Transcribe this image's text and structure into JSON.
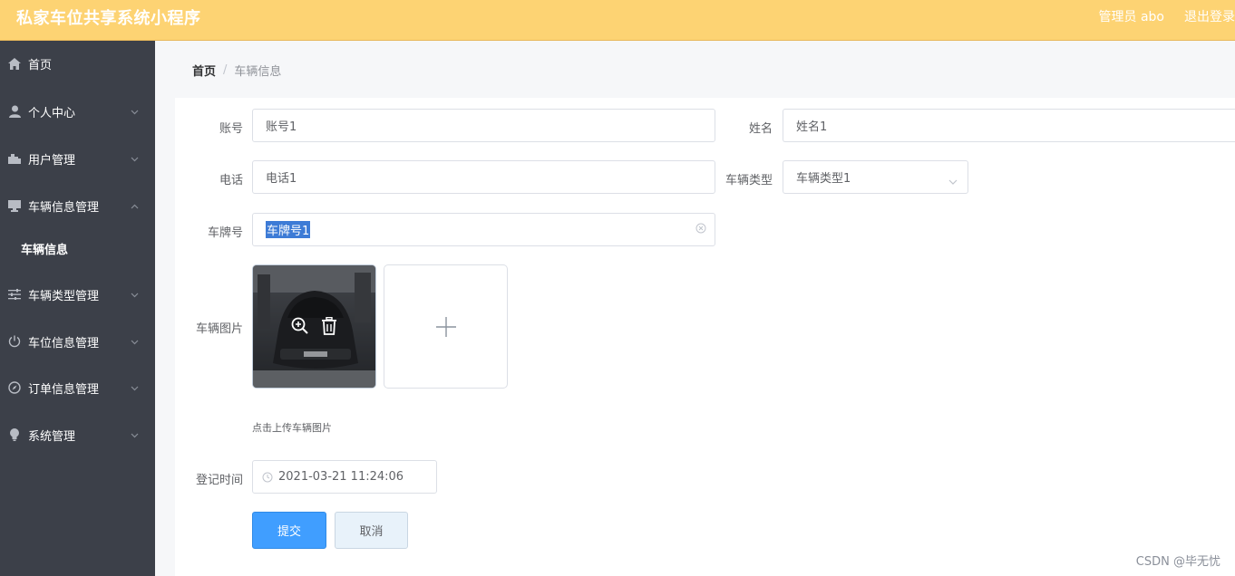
{
  "header": {
    "title": "私家车位共享系统小程序",
    "admin": "管理员 abo",
    "logout": "退出登录"
  },
  "sidebar": {
    "items": [
      {
        "label": "首页",
        "icon": "home-icon"
      },
      {
        "label": "个人中心",
        "icon": "user-icon"
      },
      {
        "label": "用户管理",
        "icon": "users-icon"
      },
      {
        "label": "车辆信息管理",
        "icon": "monitor-icon"
      },
      {
        "label": "车辆类型管理",
        "icon": "sliders-icon"
      },
      {
        "label": "车位信息管理",
        "icon": "power-icon"
      },
      {
        "label": "订单信息管理",
        "icon": "compass-icon"
      },
      {
        "label": "系统管理",
        "icon": "bulb-icon"
      }
    ],
    "sub_active": "车辆信息"
  },
  "breadcrumb": {
    "home": "首页",
    "separator": "/",
    "current": "车辆信息"
  },
  "form": {
    "account": {
      "label": "账号",
      "value": "账号1"
    },
    "name": {
      "label": "姓名",
      "value": "姓名1"
    },
    "phone": {
      "label": "电话",
      "value": "电话1"
    },
    "vehicle_type": {
      "label": "车辆类型",
      "value": "车辆类型1"
    },
    "plate": {
      "label": "车牌号",
      "value": "车牌号1"
    },
    "image": {
      "label": "车辆图片",
      "tip": "点击上传车辆图片"
    },
    "register_time": {
      "label": "登记时间",
      "value": "2021-03-21 11:24:06"
    },
    "submit_label": "提交",
    "cancel_label": "取消"
  },
  "watermark": "CSDN @毕无忧",
  "colors": {
    "header_bg": "#fdd373",
    "sidebar_bg": "#3c4049",
    "primary": "#409eff"
  }
}
